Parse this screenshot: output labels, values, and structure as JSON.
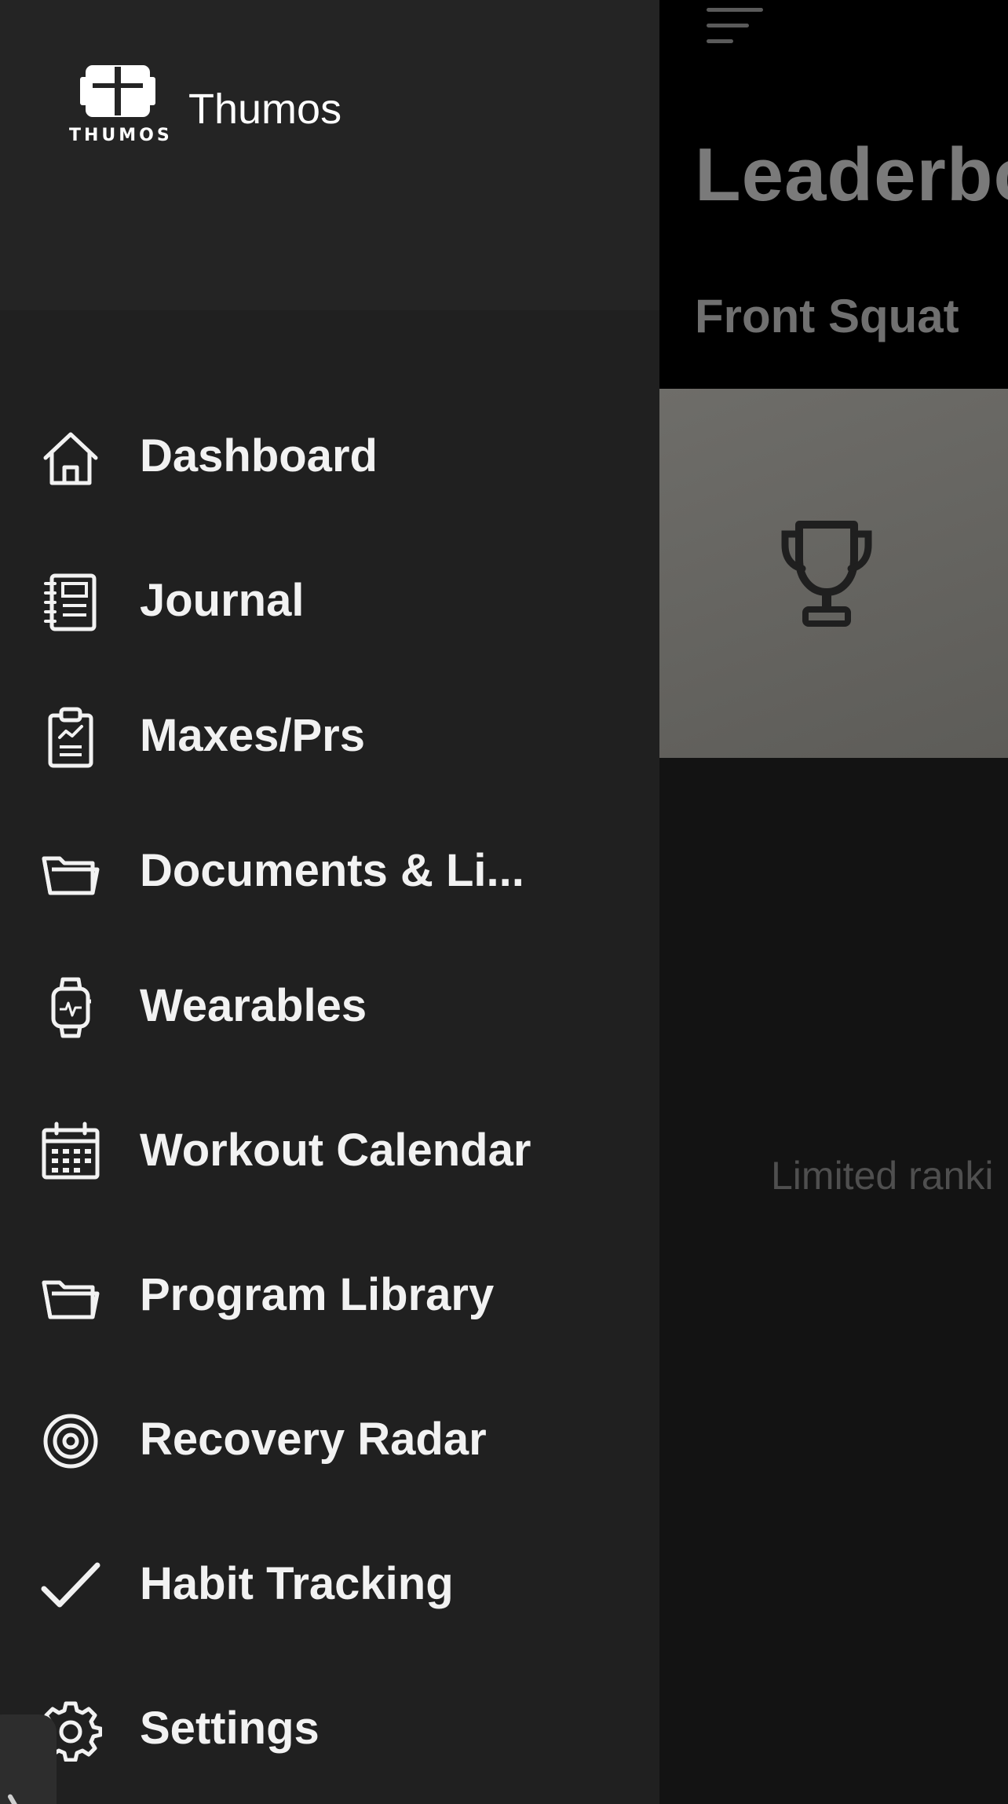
{
  "background": {
    "title": "Leaderbo",
    "subtitle": "Front Squat",
    "empty_text": "Limited ranki",
    "menu_icon": "hamburger-sort-icon",
    "card_icon": "trophy-icon",
    "colors": {
      "header_bg": "#000000",
      "body_bg": "#131313",
      "card_bg": "#6e6d69"
    }
  },
  "drawer": {
    "app_name": "Thumos",
    "logo_text": "THUMOS",
    "logo_icon": "barbell-cross-logo",
    "colors": {
      "header_bg": "#242424",
      "body_bg": "#202020",
      "text": "#f2f2f2"
    },
    "items": [
      {
        "label": "Dashboard",
        "icon": "home-icon"
      },
      {
        "label": "Journal",
        "icon": "notebook-icon"
      },
      {
        "label": "Maxes/Prs",
        "icon": "clipboard-chart-icon"
      },
      {
        "label": "Documents & Li...",
        "icon": "folder-open-icon"
      },
      {
        "label": "Wearables",
        "icon": "smartwatch-icon"
      },
      {
        "label": "Workout Calendar",
        "icon": "calendar-icon"
      },
      {
        "label": "Program Library",
        "icon": "folder-open-icon"
      },
      {
        "label": "Recovery Radar",
        "icon": "target-icon"
      },
      {
        "label": "Habit Tracking",
        "icon": "checkmark-icon"
      },
      {
        "label": "Settings",
        "icon": "gear-icon"
      }
    ]
  }
}
